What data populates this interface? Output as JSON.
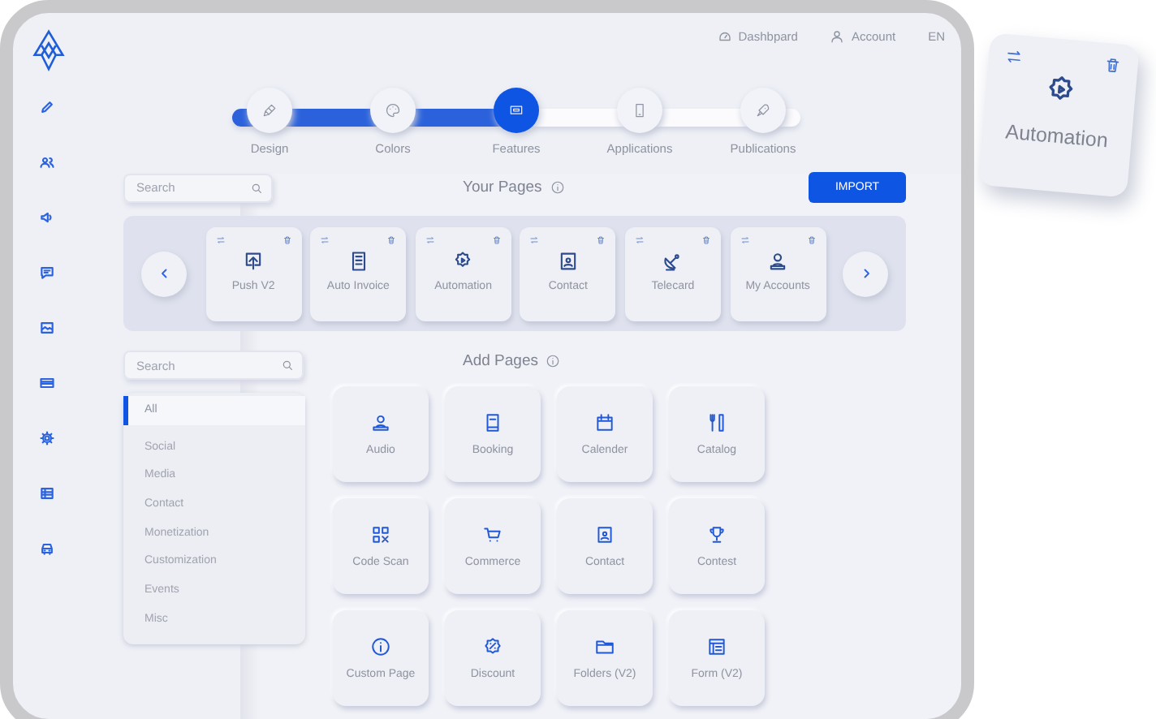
{
  "top_nav": [
    {
      "label": "Dashbpard"
    },
    {
      "label": "Account"
    },
    {
      "label": "EN"
    }
  ],
  "stepper": {
    "level": 0.5,
    "steps": [
      {
        "label": "Design",
        "selected": false
      },
      {
        "label": "Colors",
        "selected": false
      },
      {
        "label": "Features",
        "selected": true
      },
      {
        "label": "Applications",
        "selected": false
      },
      {
        "label": "Publications",
        "selected": false
      }
    ]
  },
  "your_pages": {
    "search": {
      "placeholder": "Search"
    },
    "title": "Your Pages",
    "import_button": "IMPORT",
    "pages": [
      {
        "label": "Push V2"
      },
      {
        "label": "Auto Invoice"
      },
      {
        "label": "Automation"
      },
      {
        "label": "Contact"
      },
      {
        "label": "Telecard"
      },
      {
        "label": "My Accounts"
      }
    ]
  },
  "add_pages": {
    "search": {
      "placeholder": "Search"
    },
    "categories": [
      {
        "label": "All",
        "selected": true
      },
      {
        "label": "Social",
        "selected": false
      },
      {
        "label": "Media",
        "selected": false
      },
      {
        "label": "Contact",
        "selected": false
      },
      {
        "label": "Monetization",
        "selected": false
      },
      {
        "label": "Customization",
        "selected": false
      },
      {
        "label": "Events",
        "selected": false
      },
      {
        "label": "Misc",
        "selected": false
      }
    ],
    "title": "Add Pages",
    "pages": [
      {
        "label": "Audio"
      },
      {
        "label": "Booking"
      },
      {
        "label": "Calender"
      },
      {
        "label": "Catalog"
      },
      {
        "label": "Code Scan"
      },
      {
        "label": "Commerce"
      },
      {
        "label": "Contact"
      },
      {
        "label": "Contest"
      },
      {
        "label": "Custom Page"
      },
      {
        "label": "Discount"
      },
      {
        "label": "Folders (V2)"
      },
      {
        "label": "Form (V2)"
      }
    ]
  },
  "floating_card": {
    "label": "Automation"
  }
}
